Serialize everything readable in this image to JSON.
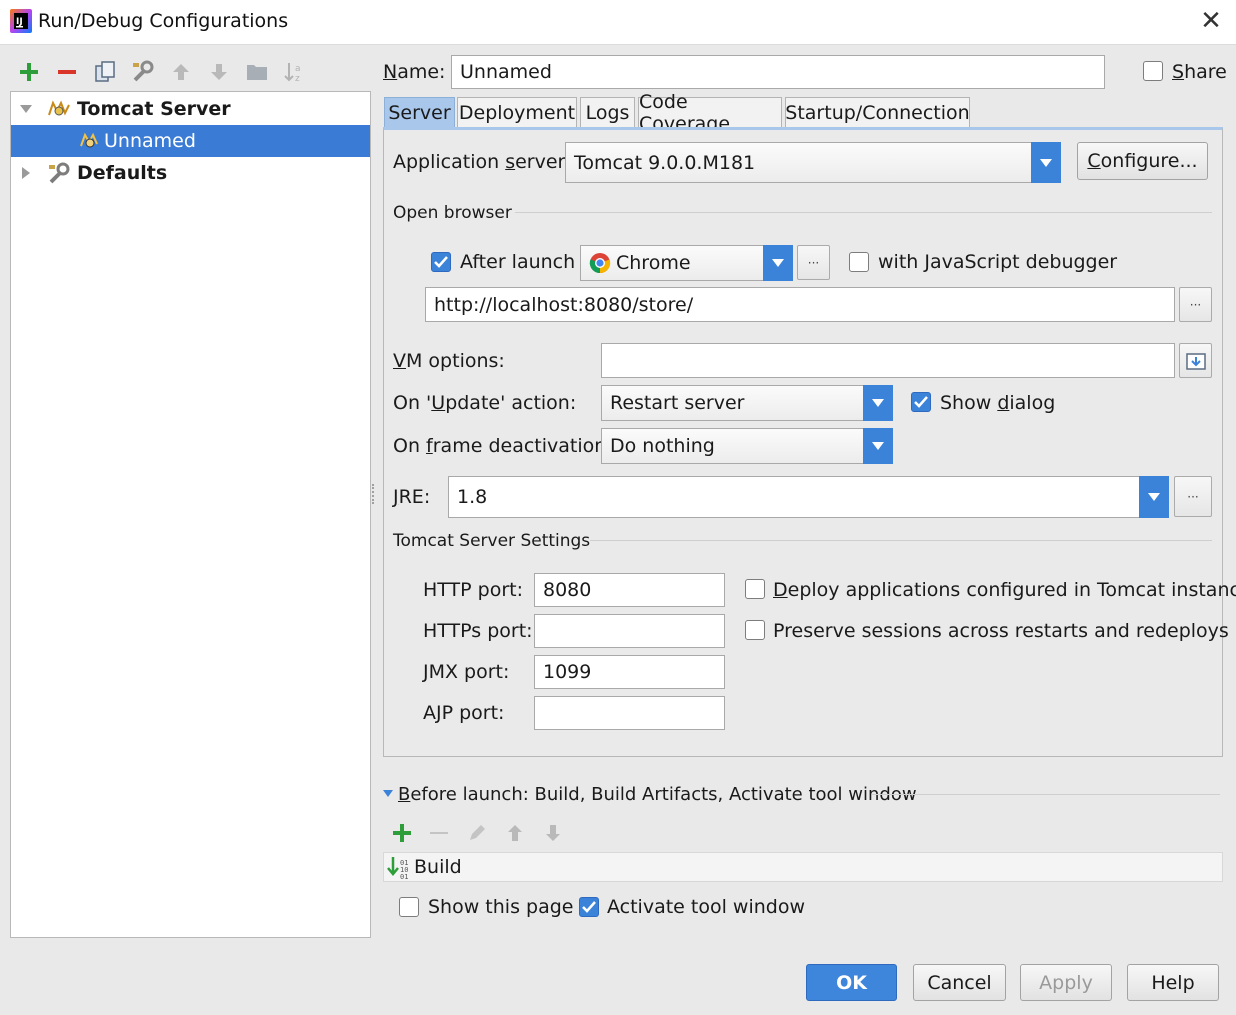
{
  "window": {
    "title": "Run/Debug Configurations",
    "close_glyph": "✕"
  },
  "toolbar": {
    "icons": [
      "add-icon",
      "remove-icon",
      "copy-icon",
      "edit-defaults-icon",
      "move-up-icon",
      "move-down-icon",
      "folder-icon",
      "sort-icon"
    ]
  },
  "tree": {
    "group": "Tomcat Server",
    "child": "Unnamed",
    "defaults": "Defaults"
  },
  "name_row": {
    "label_u": "N",
    "label_rest": "ame:",
    "value": "Unnamed",
    "share_label": "Share",
    "share_checked": false
  },
  "tabs": [
    "Server",
    "Deployment",
    "Logs",
    "Code Coverage",
    "Startup/Connection"
  ],
  "server": {
    "app_server_label_pre": "Application ",
    "app_server_label_u": "s",
    "app_server_label_post": "erver:",
    "app_server_value": "Tomcat 9.0.0.M181",
    "configure_label": "Configure...",
    "open_browser_label": "Open browser",
    "after_launch_label": "After launch",
    "after_launch_checked": true,
    "browser": "Chrome",
    "js_debugger_pre": "with ",
    "js_debugger_u": "J",
    "js_debugger_post": "avaScript debugger",
    "js_debugger_checked": false,
    "url": "http://localhost:8080/store/",
    "vm_label_u": "V",
    "vm_label_rest": "M options:",
    "vm_value": "",
    "update_label_pre": "On '",
    "update_label_u": "U",
    "update_label_post": "pdate' action:",
    "update_value": "Restart server",
    "show_dialog_pre": "Show ",
    "show_dialog_u": "d",
    "show_dialog_post": "ialog",
    "show_dialog_checked": true,
    "frame_label_pre": "On ",
    "frame_label_u": "f",
    "frame_label_post": "rame deactivation:",
    "frame_value": "Do nothing",
    "jre_label_u": "J",
    "jre_label_rest": "RE:",
    "jre_value": "1.8",
    "tomcat_settings_label": "Tomcat Server Settings",
    "http_label": "HTTP port:",
    "http_value": "8080",
    "https_label": "HTTPs port:",
    "https_value": "",
    "jmx_label": "JMX port:",
    "jmx_value": "1099",
    "ajp_label": "AJP port:",
    "ajp_value": "",
    "deploy_label_u": "D",
    "deploy_label_rest": "eploy applications configured in Tomcat instance",
    "deploy_checked": false,
    "preserve_label": "Preserve sessions across restarts and redeploys",
    "preserve_checked": false
  },
  "before_launch": {
    "label_u": "B",
    "label_rest": "efore launch: Build, Build Artifacts, Activate tool window",
    "item": "Build",
    "show_page_label": "Show this page",
    "show_page_checked": false,
    "activate_label": "Activate tool window",
    "activate_checked": true
  },
  "buttons": {
    "ok": "OK",
    "cancel": "Cancel",
    "apply": "Apply",
    "help": "Help"
  },
  "colors": {
    "accent": "#3b83d9",
    "selection": "#3a7bd5",
    "ok_button": "#3d86dc",
    "add_green": "#2e9e3a",
    "remove_red": "#d9352b"
  }
}
